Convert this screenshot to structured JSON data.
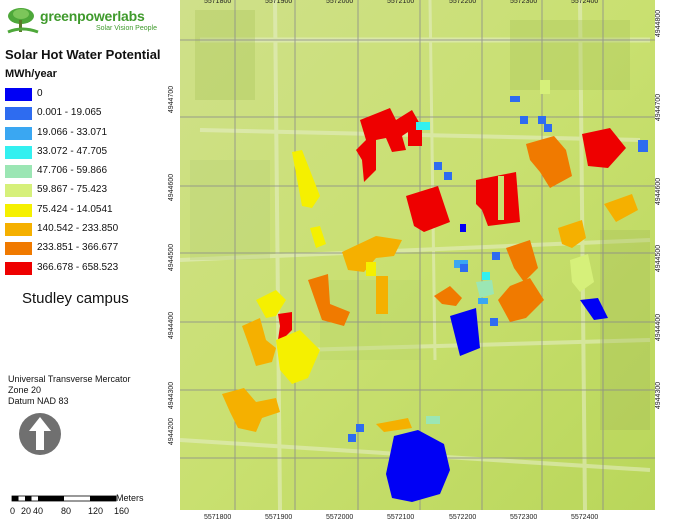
{
  "branding": {
    "name": "greenpowerlabs",
    "tagline": "Solar Vision People"
  },
  "legend": {
    "title": "Solar Hot Water Potential",
    "units": "MWh/year",
    "classes": [
      {
        "label": "0",
        "color": "#0000f5"
      },
      {
        "label": "0.001 - 19.065",
        "color": "#2e6cf0"
      },
      {
        "label": "19.066 - 33.071",
        "color": "#3aa7f2"
      },
      {
        "label": "33.072 - 47.705",
        "color": "#33f0f0"
      },
      {
        "label": "47.706 - 59.866",
        "color": "#9be6b4"
      },
      {
        "label": "59.867 - 75.423",
        "color": "#d6f07a"
      },
      {
        "label": "75.424 - 14.0541",
        "color": "#f5f000"
      },
      {
        "label": "140.542 - 233.850",
        "color": "#f5b000"
      },
      {
        "label": "233.851 - 366.677",
        "color": "#f07a00"
      },
      {
        "label": "366.678 - 658.523",
        "color": "#ee0000"
      }
    ]
  },
  "place": "Studley campus",
  "projection": {
    "line1": "Universal Transverse Mercator",
    "line2": "Zone 20",
    "line3": "Datum NAD 83"
  },
  "scale_bar": {
    "ticks": [
      "0",
      "20",
      "40",
      "80",
      "120",
      "160"
    ],
    "unit": "Meters"
  },
  "map": {
    "easting_labels": [
      "5571800",
      "5571900",
      "5572000",
      "5572100",
      "5572200",
      "5572300",
      "5572400"
    ],
    "northing_right": [
      "4944800",
      "4944700",
      "4944600",
      "4944500",
      "4944400",
      "4944300"
    ],
    "northing_left": [
      "4944700",
      "4944600",
      "4944500",
      "4944400",
      "4944300",
      "4944200"
    ]
  }
}
